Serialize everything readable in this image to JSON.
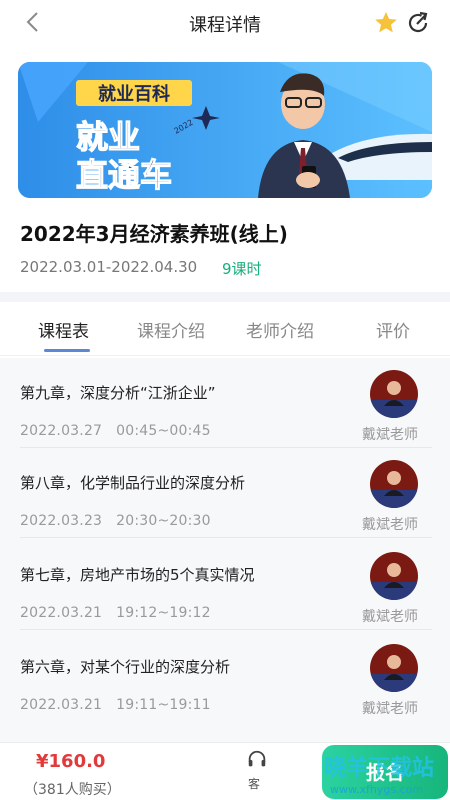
{
  "header": {
    "title": "课程详情",
    "back_icon": "chevron-left-icon",
    "favorite_icon": "star-icon",
    "share_icon": "share-icon",
    "star_color": "#f6c23a"
  },
  "banner": {
    "top_label": "就业百科",
    "main_line1": "就业",
    "main_line2": "直通车",
    "year_text": "2022"
  },
  "course": {
    "title": "2022年3月经济素养班(线上)",
    "date_range": "2022.03.01-2022.04.30",
    "lessons": "9课时"
  },
  "tabs": [
    {
      "label": "课程表",
      "active": true
    },
    {
      "label": "课程介绍",
      "active": false
    },
    {
      "label": "老师介绍",
      "active": false
    },
    {
      "label": "评价",
      "active": false
    }
  ],
  "chapters": [
    {
      "title": "第九章，深度分析“江浙企业”",
      "date": "2022.03.27",
      "time": "00:45~00:45",
      "teacher": "戴斌老师"
    },
    {
      "title": "第八章，化学制品行业的深度分析",
      "date": "2022.03.23",
      "time": "20:30~20:30",
      "teacher": "戴斌老师"
    },
    {
      "title": "第七章，房地产市场的5个真实情况",
      "date": "2022.03.21",
      "time": "19:12~19:12",
      "teacher": "戴斌老师"
    },
    {
      "title": "第六章，对某个行业的深度分析",
      "date": "2022.03.21",
      "time": "19:11~19:11",
      "teacher": "戴斌老师"
    }
  ],
  "footer": {
    "price": "¥160.0",
    "buyers": "（381人购买）",
    "cs_label": "客",
    "enroll_label": "报名",
    "watermark_text": "晓羊下载站",
    "watermark_url": "www.xfhygs.com",
    "accent": "#17b57c"
  }
}
